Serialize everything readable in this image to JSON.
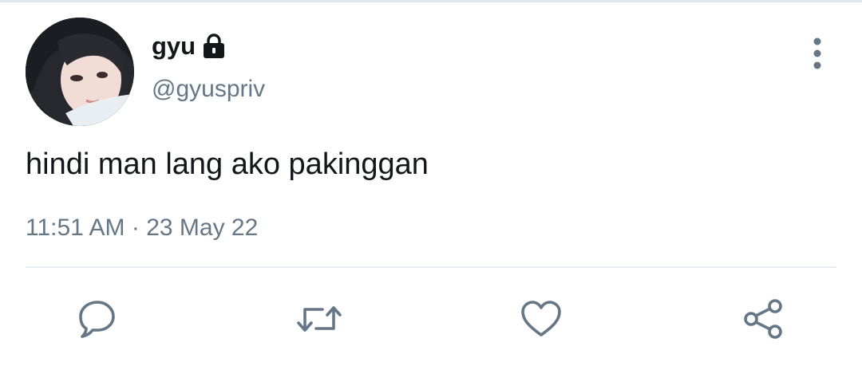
{
  "tweet": {
    "display_name": "gyu",
    "handle": "@gyuspriv",
    "text": "hindi man lang ako pakinggan",
    "time": "11:51 AM",
    "separator": "·",
    "date": "23 May 22",
    "protected": true
  },
  "icons": {
    "lock": "lock-icon",
    "more": "more-vertical-icon",
    "reply": "reply-icon",
    "retweet": "retweet-icon",
    "like": "heart-icon",
    "share": "share-icon"
  },
  "colors": {
    "text": "#14171a",
    "secondary": "#657786",
    "divider": "#e6ecf0"
  }
}
